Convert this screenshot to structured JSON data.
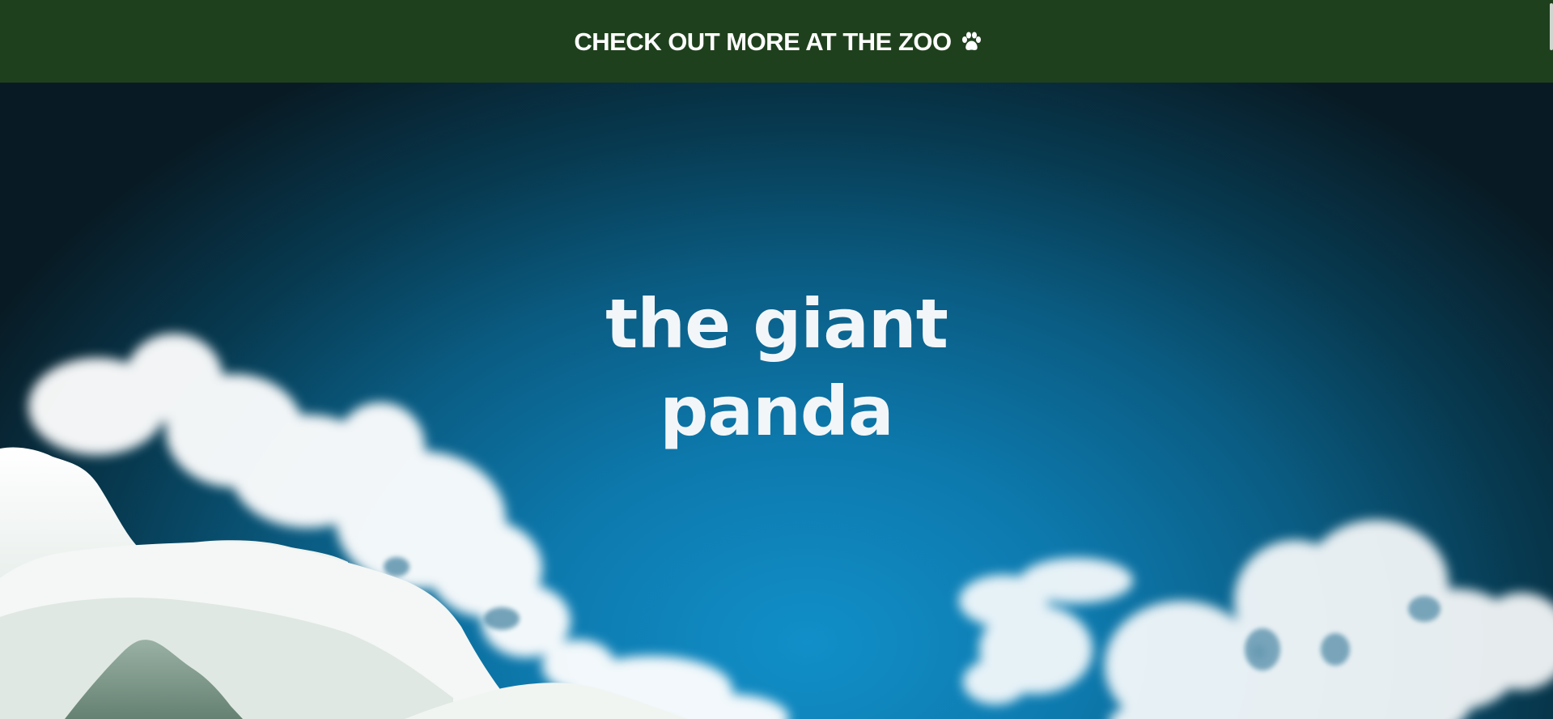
{
  "banner": {
    "link_text": "CHECK OUT MORE AT THE ZOO",
    "icon": "paw-icon",
    "background": "#1f401c"
  },
  "hero": {
    "title_line1": "the giant",
    "title_line2": "panda",
    "sky_color": "#118fc8"
  }
}
